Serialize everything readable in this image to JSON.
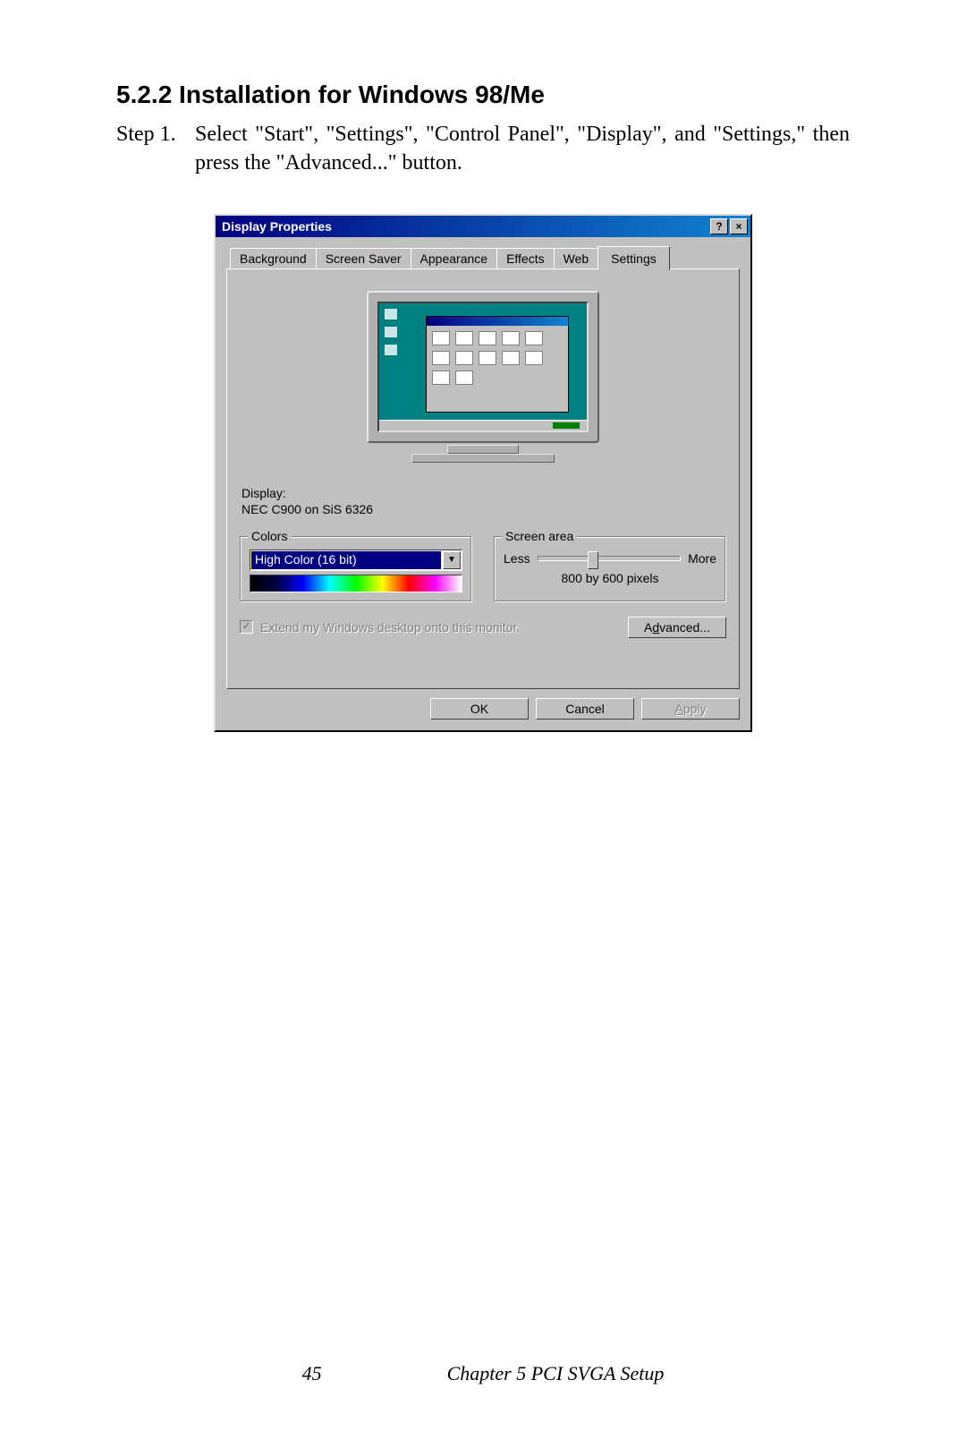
{
  "doc": {
    "section_title": "5.2.2  Installation for Windows 98/Me",
    "step_label": "Step 1.",
    "step_text": "Select \"Start\", \"Settings\", \"Control Panel\", \"Display\", and \"Settings,\" then press the \"Advanced...\" button."
  },
  "dialog": {
    "title": "Display Properties",
    "help_glyph": "?",
    "close_glyph": "×",
    "tabs": {
      "background": "Background",
      "screensaver": "Screen Saver",
      "appearance": "Appearance",
      "effects": "Effects",
      "web": "Web",
      "settings": "Settings"
    },
    "display_label": "Display:",
    "display_value": "NEC C900 on SiS 6326",
    "colors": {
      "legend": "Colors",
      "selected": "High Color (16 bit)",
      "dropdown_glyph": "▼"
    },
    "screenarea": {
      "legend": "Screen area",
      "less": "Less",
      "more": "More",
      "resolution": "800 by 600 pixels"
    },
    "extend_check_glyph": "✓",
    "extend_label": "Extend my Windows desktop onto this monitor.",
    "advanced_prefix": "A",
    "advanced_u": "d",
    "advanced_suffix": "vanced...",
    "ok": "OK",
    "cancel": "Cancel",
    "apply_u": "A",
    "apply_suffix": "pply"
  },
  "footer": {
    "page": "45",
    "chapter": "Chapter 5  PCI SVGA Setup"
  }
}
